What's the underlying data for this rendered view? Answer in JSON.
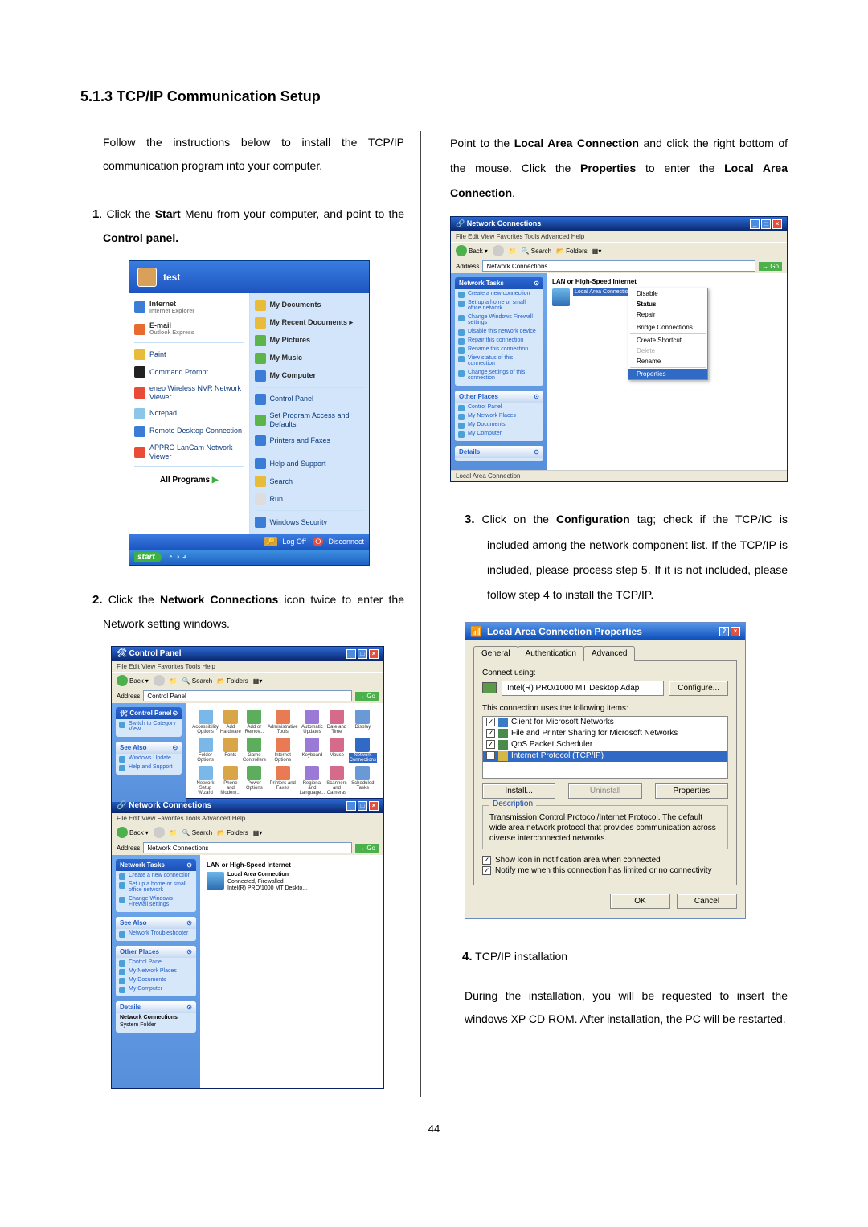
{
  "heading": "5.1.3 TCP/IP Communication Setup",
  "intro": "Follow the instructions below to install the TCP/IP communication program into your computer.",
  "step1_num": "1",
  "step1_a": ". Click the ",
  "step1_b": "Start",
  "step1_c": " Menu from your computer, and point to the ",
  "step1_d": "Control panel.",
  "start_menu": {
    "user": "test",
    "left_top": [
      {
        "title": "Internet",
        "sub": "Internet Explorer"
      },
      {
        "title": "E-mail",
        "sub": "Outlook Express"
      }
    ],
    "left_items": [
      "Paint",
      "Command Prompt",
      "eneo Wireless NVR Network Viewer",
      "Notepad",
      "Remote Desktop Connection",
      "APPRO LanCam Network Viewer"
    ],
    "all_programs": "All Programs",
    "right_items_top": [
      "My Documents",
      "My Recent Documents  ▸",
      "My Pictures",
      "My Music",
      "My Computer"
    ],
    "right_items_bottom": [
      "Control Panel",
      "Set Program Access and Defaults",
      "Printers and Faxes",
      "Help and Support",
      "Search",
      "Run...",
      "Windows Security"
    ],
    "footer": [
      "Log Off",
      "Disconnect"
    ],
    "taskbar": "start"
  },
  "step2_num": "2.",
  "step2_a": "  Click the ",
  "step2_b": "Network Connections",
  "step2_c": " icon twice to enter the Network setting windows.",
  "cp_window": {
    "title": "Control Panel",
    "menu": "File   Edit   View   Favorites   Tools   Help",
    "toolbar": {
      "back": "Back",
      "search": "Search",
      "folders": "Folders"
    },
    "address_label": "Address",
    "address_value": "Control Panel",
    "go": "Go",
    "side1_h": "Control Panel",
    "side1_items": [
      "Switch to Category View"
    ],
    "side2_h": "See Also",
    "side2_items": [
      "Windows Update",
      "Help and Support"
    ],
    "icons": [
      "Accessibility Options",
      "Add Hardware",
      "Add or Remov...",
      "Administrative Tools",
      "Automatic Updates",
      "Date and Time",
      "Display",
      "Folder Options",
      "Fonts",
      "Game Controllers",
      "Internet Options",
      "Keyboard",
      "Mouse",
      "Network Connections",
      "Network Setup Wizard",
      "Phone and Modem...",
      "Power Options",
      "Printers and Faxes",
      "Regional and Language...",
      "Scanners and Cameras",
      "Scheduled Tasks"
    ]
  },
  "nc_window": {
    "title": "Network Connections",
    "menu": "File   Edit   View   Favorites   Tools   Advanced   Help",
    "address_value": "Network Connections",
    "side_tasks_h": "Network Tasks",
    "side_tasks": [
      "Create a new connection",
      "Set up a home or small office network",
      "Change Windows Firewall settings"
    ],
    "side_see_h": "See Also",
    "side_see": [
      "Network Troubleshooter"
    ],
    "side_other_h": "Other Places",
    "side_other": [
      "Control Panel",
      "My Network Places",
      "My Documents",
      "My Computer"
    ],
    "side_details_h": "Details",
    "side_details": [
      "Network Connections",
      "System Folder"
    ],
    "group": "LAN or High-Speed Internet",
    "item_name": "Local Area Connection",
    "item_status": "Connected, Firewalled",
    "item_device": "Intel(R) PRO/1000 MT Deskto..."
  },
  "right_intro_a": "Point to the ",
  "right_intro_b": "Local Area Connection",
  "right_intro_c": " and click the right bottom of the mouse. Click the ",
  "right_intro_d": "Properties",
  "right_intro_e": " to enter the ",
  "right_intro_f": "Local Area Connection",
  "right_intro_g": ".",
  "nc2": {
    "title": "Network Connections",
    "menu": "File   Edit   View   Favorites   Tools   Advanced   Help",
    "address_value": "Network Connections",
    "group": "LAN or High-Speed Internet",
    "selected": "Local Area Connection",
    "ctx": [
      "Disable",
      "Status",
      "Repair",
      "Bridge Connections",
      "Create Shortcut",
      "Delete",
      "Rename",
      "Properties"
    ],
    "side_tasks": [
      "Create a new connection",
      "Set up a home or small office network",
      "Change Windows Firewall settings",
      "Disable this network device",
      "Repair this connection",
      "Rename this connection",
      "View status of this connection",
      "Change settings of this connection"
    ],
    "side_other": [
      "Control Panel",
      "My Network Places",
      "My Documents",
      "My Computer"
    ],
    "statusbar": "Local Area Connection"
  },
  "step3_num": "3.",
  "step3_a": "  Click on the ",
  "step3_b": "Configuration",
  "step3_c": " tag; check if the TCP/IC is included among the network component list. If the TCP/IP is included, please process step 5. If it is not included, please follow step 4 to install the TCP/IP.",
  "props": {
    "title": "Local Area Connection Properties",
    "tab_general": "General",
    "tab_auth": "Authentication",
    "tab_adv": "Advanced",
    "connect_using": "Connect using:",
    "device": "Intel(R) PRO/1000 MT Desktop Adap",
    "configure": "Configure...",
    "items_label": "This connection uses the following items:",
    "items": [
      "Client for Microsoft Networks",
      "File and Printer Sharing for Microsoft Networks",
      "QoS Packet Scheduler",
      "Internet Protocol (TCP/IP)"
    ],
    "install": "Install...",
    "uninstall": "Uninstall",
    "properties_btn": "Properties",
    "desc_h": "Description",
    "desc": "Transmission Control Protocol/Internet Protocol. The default wide area network protocol that provides communication across diverse interconnected networks.",
    "show_icon": "Show icon in notification area when connected",
    "notify": "Notify me when this connection has limited or no connectivity",
    "ok": "OK",
    "cancel": "Cancel"
  },
  "step4_num": "4.",
  "step4_title": "  TCP/IP installation",
  "step4_body": "During the installation, you will be requested to insert the windows XP CD ROM. After installation, the PC will be restarted.",
  "page_num": "44"
}
